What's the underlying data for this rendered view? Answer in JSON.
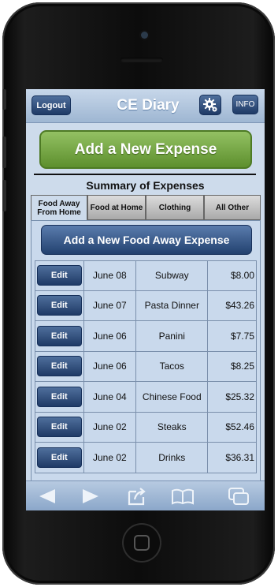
{
  "header": {
    "logout_label": "Logout",
    "title": "CE Diary",
    "info_label": "INFO"
  },
  "main": {
    "add_expense_label": "Add a New Expense",
    "summary_title": "Summary of Expenses"
  },
  "tabs": [
    {
      "label": "Food Away From Home",
      "active": true
    },
    {
      "label": "Food at Home",
      "active": false
    },
    {
      "label": "Clothing",
      "active": false
    },
    {
      "label": "All Other",
      "active": false
    }
  ],
  "panel": {
    "add_food_label": "Add a New Food Away Expense",
    "edit_label": "Edit",
    "expenses": [
      {
        "date": "June 08",
        "description": "Subway",
        "amount": "$8.00"
      },
      {
        "date": "June 07",
        "description": "Pasta Dinner",
        "amount": "$43.26"
      },
      {
        "date": "June 06",
        "description": "Panini",
        "amount": "$7.75"
      },
      {
        "date": "June 06",
        "description": "Tacos",
        "amount": "$8.25"
      },
      {
        "date": "June 04",
        "description": "Chinese Food",
        "amount": "$25.32"
      },
      {
        "date": "June 02",
        "description": "Steaks",
        "amount": "$52.46"
      },
      {
        "date": "June 02",
        "description": "Drinks",
        "amount": "$36.31"
      }
    ]
  },
  "toolbar": {
    "icons": [
      "back-arrow-icon",
      "forward-arrow-icon",
      "share-icon",
      "bookmarks-icon",
      "tabs-icon"
    ]
  },
  "colors": {
    "accent": "#1f3a66",
    "add_button": "#6fa33d",
    "screen_bg": "#cddbeb"
  }
}
